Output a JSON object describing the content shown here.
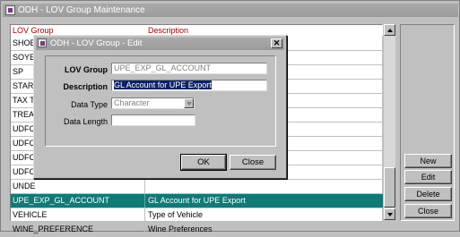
{
  "window": {
    "title": "ODH - LOV Group Maintenance"
  },
  "grid": {
    "headers": [
      "LOV Group",
      "Description"
    ],
    "rows": [
      {
        "group": "SHOE",
        "description": ""
      },
      {
        "group": "SOYE",
        "description": ""
      },
      {
        "group": "SP",
        "description": ""
      },
      {
        "group": "STAR",
        "description": ""
      },
      {
        "group": "TAX T",
        "description": ""
      },
      {
        "group": "TREAT",
        "description": ""
      },
      {
        "group": "UDFC",
        "description": ""
      },
      {
        "group": "UDFC",
        "description": ""
      },
      {
        "group": "UDFC",
        "description": ""
      },
      {
        "group": "UDFC",
        "description": ""
      },
      {
        "group": "UNDE",
        "description": ""
      },
      {
        "group": "UPE_EXP_GL_ACCOUNT",
        "description": "GL Account for UPE Export"
      },
      {
        "group": "VEHICLE",
        "description": "Type of Vehicle"
      },
      {
        "group": "WINE_PREFERENCE",
        "description": "Wine Preferences"
      }
    ],
    "selected_index": 11
  },
  "buttons": {
    "new": "New",
    "edit": "Edit",
    "delete": "Delete",
    "close": "Close"
  },
  "dialog": {
    "title": "ODH - LOV Group - Edit",
    "close_glyph": "✕",
    "lov_group_label": "LOV Group",
    "lov_group_value": "UPE_EXP_GL_ACCOUNT",
    "description_label": "Description",
    "description_value": "GL Account for UPE Export",
    "data_type_label": "Data Type",
    "data_type_value": "Character",
    "data_length_label": "Data Length",
    "data_length_value": "",
    "ok_label": "OK",
    "close_label": "Close"
  },
  "colors": {
    "selected_row": "#0f7a76",
    "header_text": "#a00000",
    "titlebar": "#a9a9a9"
  }
}
